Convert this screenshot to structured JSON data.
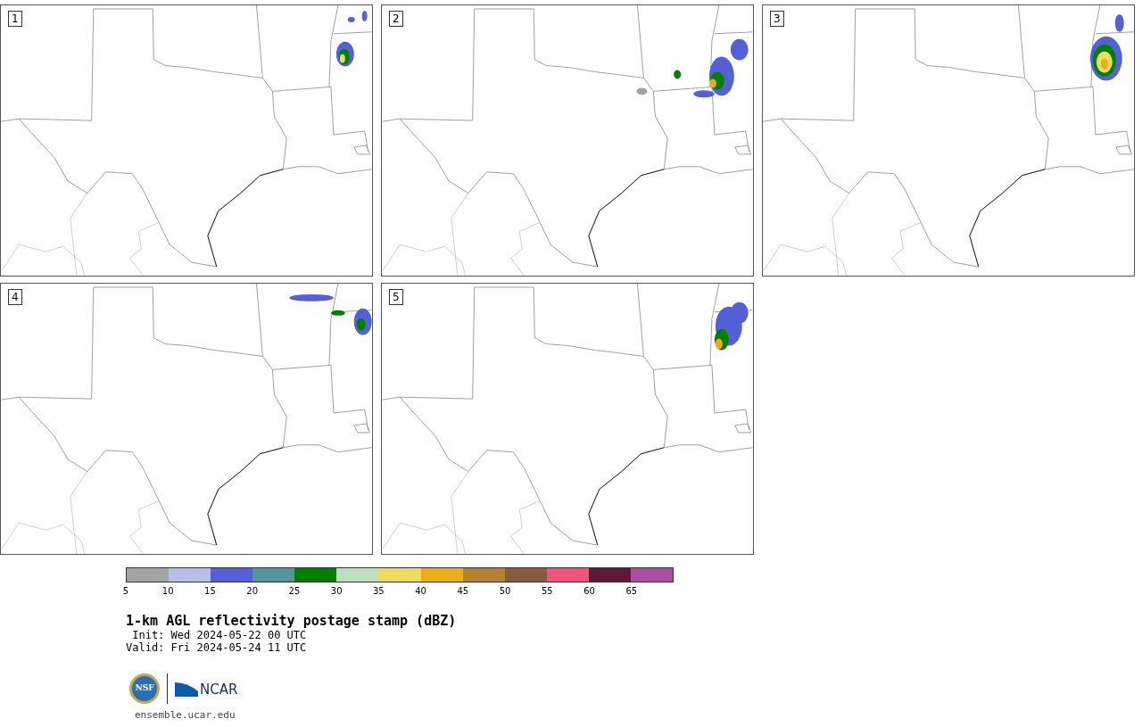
{
  "panels": [
    {
      "label": "1"
    },
    {
      "label": "2"
    },
    {
      "label": "3"
    },
    {
      "label": "4"
    },
    {
      "label": "5"
    }
  ],
  "colorbar": {
    "bins": [
      {
        "color": "#a3a3a3"
      },
      {
        "color": "#b5bfea"
      },
      {
        "color": "#5360d6"
      },
      {
        "color": "#4f9799"
      },
      {
        "color": "#008000"
      },
      {
        "color": "#bfdfbf"
      },
      {
        "color": "#efdb5e"
      },
      {
        "color": "#efac1a"
      },
      {
        "color": "#b7822f"
      },
      {
        "color": "#8a5a3c"
      },
      {
        "color": "#f4527e"
      },
      {
        "color": "#611838"
      },
      {
        "color": "#ad4ca3"
      }
    ],
    "ticks": [
      "5",
      "10",
      "15",
      "20",
      "25",
      "30",
      "35",
      "40",
      "45",
      "50",
      "55",
      "60",
      "65"
    ]
  },
  "title": "1-km AGL reflectivity postage stamp (dBZ)",
  "init": " Init: Wed 2024-05-22 00 UTC",
  "valid": "Valid: Fri 2024-05-24 11 UTC",
  "logo": {
    "seal": "NSF",
    "wordmark": "NCAR"
  },
  "footer": "ensemble.ucar.edu"
}
